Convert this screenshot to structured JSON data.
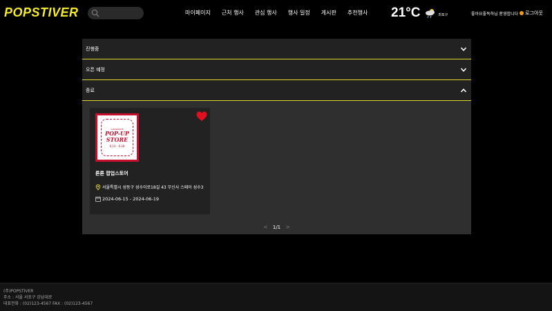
{
  "header": {
    "logo": "POPSTIVER",
    "search_placeholder": "",
    "nav": [
      "마이페이지",
      "근처 행사",
      "관심 행사",
      "행사 일정",
      "게시판",
      "추천행사"
    ],
    "temperature": "21°C",
    "weather_icon": "cloud-rain-icon",
    "location": "마포구",
    "welcome": "좋아요좋독하님 환영합니다",
    "logout": "로그아웃"
  },
  "accordion": [
    {
      "label": "진행중",
      "state": "collapsed"
    },
    {
      "label": "오픈 예정",
      "state": "collapsed"
    },
    {
      "label": "종료",
      "state": "expanded"
    }
  ],
  "cards": [
    {
      "title": "론론 팝업스토어",
      "address": "서울특별시 성동구 성수이로18길 43 무신사 스페어 성수3",
      "dates": "2024-06-15 - 2024-06-19",
      "liked": true,
      "poster": {
        "small": "CLEARANCE",
        "line1": "POP-UP",
        "line2": "STORE",
        "date": "6.14 - 6.18"
      }
    }
  ],
  "pagination": {
    "label": "1/1",
    "prev": "<",
    "next": ">"
  },
  "footer": {
    "lines": [
      "(주)POPSTIVER",
      "주소 : 서울 서초구 강남대로",
      "대표전화 : (02)123-4567 FAX : (02)123-4567"
    ]
  },
  "colors": {
    "accent": "#f5ea2a",
    "heart": "#e0101f",
    "panel": "#2f2f2f",
    "row": "#222222"
  }
}
